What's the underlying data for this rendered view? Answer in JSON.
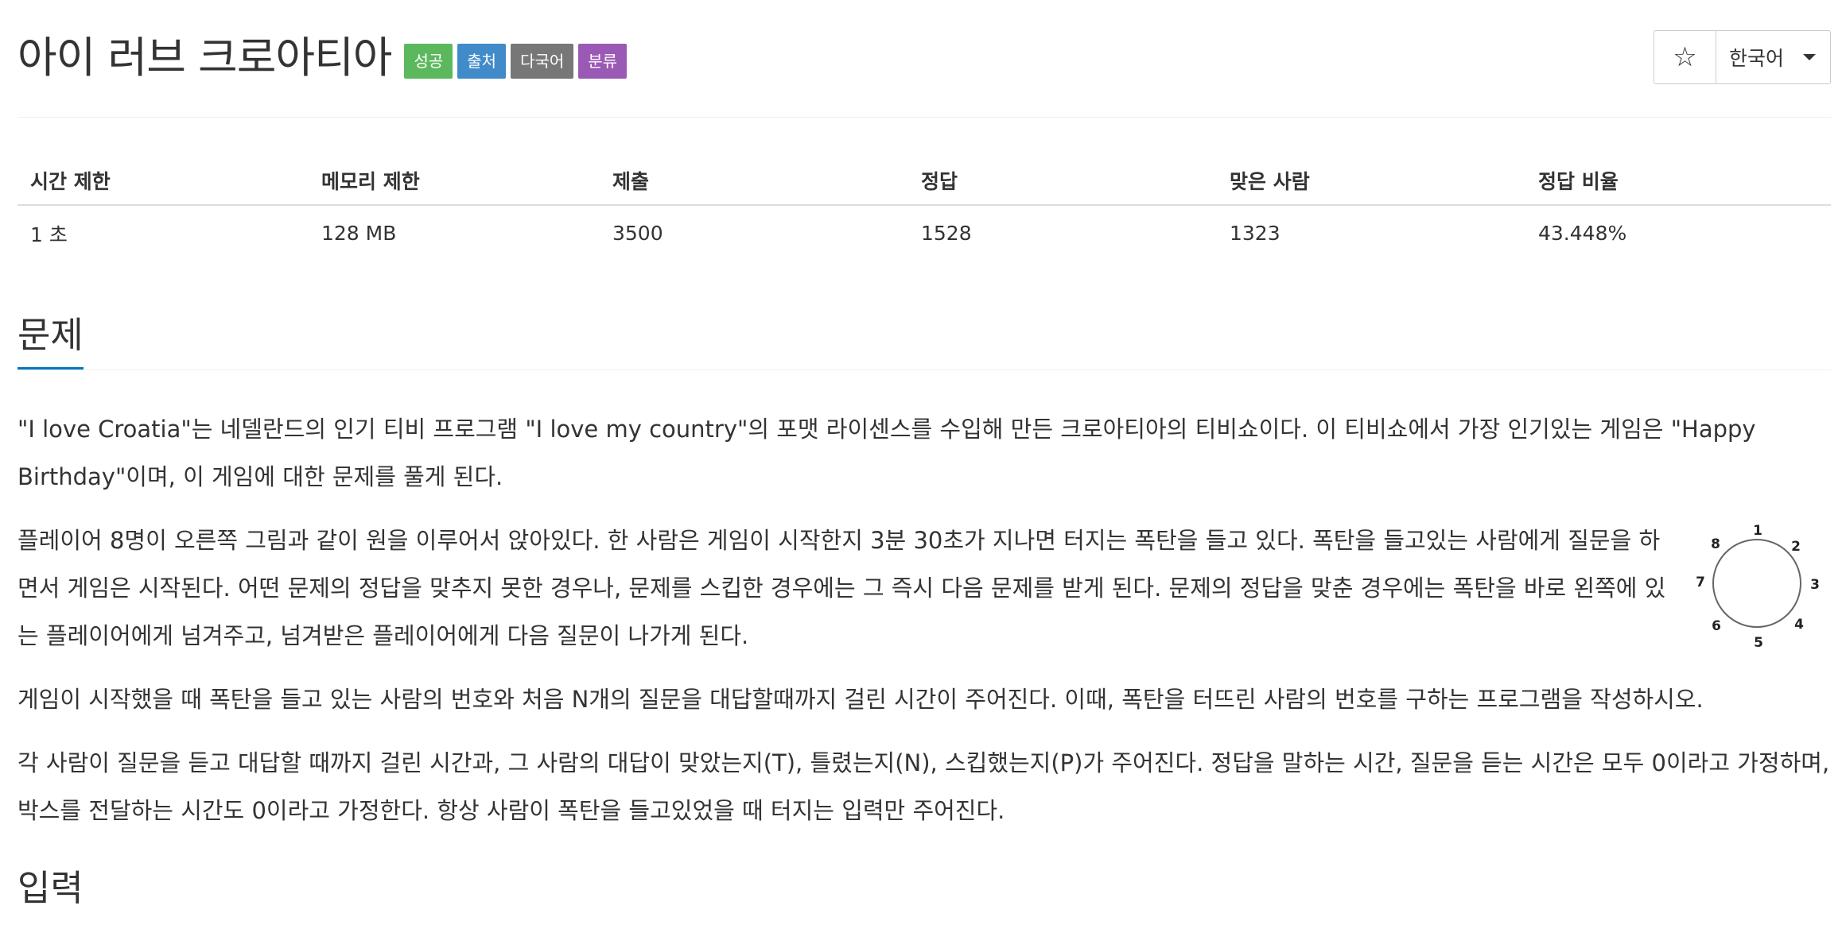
{
  "header": {
    "title": "아이 러브 크로아티아",
    "labels": [
      "성공",
      "출처",
      "다국어",
      "분류"
    ],
    "star_icon": "star-outline-icon",
    "language": "한국어"
  },
  "info_table": {
    "headers": [
      "시간 제한",
      "메모리 제한",
      "제출",
      "정답",
      "맞은 사람",
      "정답 비율"
    ],
    "values": [
      "1 초",
      "128 MB",
      "3500",
      "1528",
      "1323",
      "43.448%"
    ]
  },
  "sections": {
    "problem_title": "문제",
    "input_title": "입력"
  },
  "problem": {
    "p1": "\"I love Croatia\"는 네델란드의 인기 티비 프로그램 \"I love my country\"의 포맷 라이센스를 수입해 만든 크로아티아의 티비쇼이다. 이 티비쇼에서 가장 인기있는 게임은 \"Happy Birthday\"이며, 이 게임에 대한 문제를 풀게 된다.",
    "p2": "플레이어 8명이 오른쪽 그림과 같이 원을 이루어서 앉아있다. 한 사람은 게임이 시작한지 3분 30초가 지나면 터지는 폭탄을 들고 있다. 폭탄을 들고있는 사람에게 질문을 하면서 게임은 시작된다. 어떤 문제의 정답을 맞추지 못한 경우나, 문제를 스킵한 경우에는 그 즉시 다음 문제를 받게 된다. 문제의 정답을 맞춘 경우에는 폭탄을 바로 왼쪽에 있는 플레이어에게 넘겨주고, 넘겨받은 플레이어에게 다음 질문이 나가게 된다.",
    "p3": "게임이 시작했을 때 폭탄을 들고 있는 사람의 번호와 처음 N개의 질문을 대답할때까지 걸린 시간이 주어진다. 이때, 폭탄을 터뜨린 사람의 번호를 구하는 프로그램을 작성하시오.",
    "p4": "각 사람이 질문을 듣고 대답할 때까지 걸린 시간과, 그 사람의 대답이 맞았는지(T), 틀렸는지(N), 스킵했는지(P)가 주어진다. 정답을 말하는 시간, 질문을 듣는 시간은 모두 0이라고 가정하며, 박스를 전달하는 시간도 0이라고 가정한다. 항상 사람이 폭탄을 들고있었을 때 터지는 입력만 주어진다."
  },
  "figure": {
    "players": [
      "1",
      "2",
      "3",
      "4",
      "5",
      "6",
      "7",
      "8"
    ]
  }
}
